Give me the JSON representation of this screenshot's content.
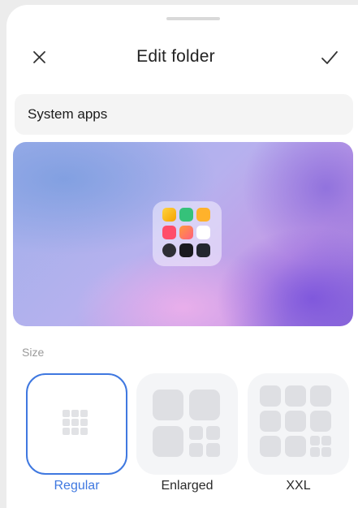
{
  "dialog": {
    "title": "Edit folder",
    "folder_name": "System apps"
  },
  "size_section": {
    "label": "Size",
    "options": [
      {
        "label": "Regular",
        "selected": true
      },
      {
        "label": "Enlarged",
        "selected": false
      },
      {
        "label": "XXL",
        "selected": false
      }
    ]
  },
  "colors": {
    "accent": "#3f78e0"
  },
  "icons": {
    "close": "close-icon",
    "confirm": "checkmark-icon"
  }
}
